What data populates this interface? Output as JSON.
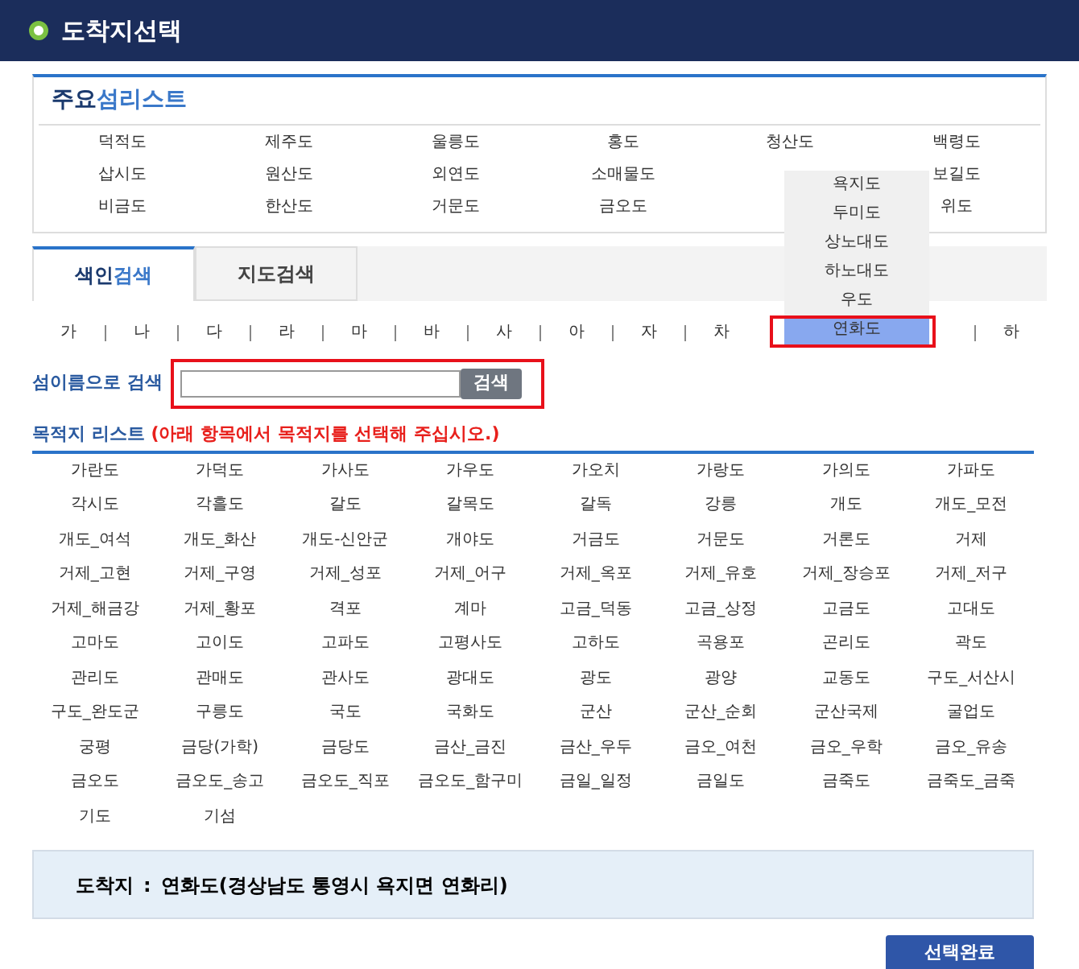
{
  "window": {
    "title": "도착지선택"
  },
  "major_islands": {
    "title": [
      "주요",
      "섬리스트"
    ],
    "rows": [
      [
        "덕적도",
        "제주도",
        "울릉도",
        "홍도",
        "청산도",
        "백령도"
      ],
      [
        "삽시도",
        "원산도",
        "외연도",
        "소매물도",
        "보길도"
      ],
      [
        "비금도",
        "한산도",
        "거문도",
        "금오도",
        "위도"
      ]
    ]
  },
  "tabs": [
    {
      "label": [
        "색인",
        "검색"
      ],
      "selected": true
    },
    {
      "label": [
        "지도검색"
      ],
      "selected": false
    }
  ],
  "index_letters": [
    "가",
    "나",
    "다",
    "라",
    "마",
    "바",
    "사",
    "아",
    "자",
    "차",
    "하"
  ],
  "dropdown": [
    {
      "text": "욕지도",
      "selected": false
    },
    {
      "text": "두미도",
      "selected": false
    },
    {
      "text": "상노대도",
      "selected": false
    },
    {
      "text": "하노대도",
      "selected": false
    },
    {
      "text": "우도",
      "selected": false
    },
    {
      "text": "연화도",
      "selected": true
    }
  ],
  "search": {
    "label": "섬이름으로 검색",
    "button": "검색"
  },
  "destination_list": {
    "title": "목적지 리스트",
    "hint": "(아래 항목에서 목적지를 선택해 주십시오.)",
    "items": [
      "가란도",
      "가덕도",
      "가사도",
      "가우도",
      "가오치",
      "가랑도",
      "가의도",
      "가파도",
      "각시도",
      "각흘도",
      "갈도",
      "갈목도",
      "갈독",
      "강릉",
      "개도",
      "개도_모전",
      "개도_여석",
      "개도_화산",
      "개도-신안군",
      "개야도",
      "거금도",
      "거문도",
      "거론도",
      "거제",
      "거제_고현",
      "거제_구영",
      "거제_성포",
      "거제_어구",
      "거제_옥포",
      "거제_유호",
      "거제_장승포",
      "거제_저구",
      "거제_해금강",
      "거제_황포",
      "격포",
      "계마",
      "고금_덕동",
      "고금_상정",
      "고금도",
      "고대도",
      "고마도",
      "고이도",
      "고파도",
      "고평사도",
      "고하도",
      "곡용포",
      "곤리도",
      "곽도",
      "관리도",
      "관매도",
      "관사도",
      "광대도",
      "광도",
      "광양",
      "교동도",
      "구도_서산시",
      "구도_완도군",
      "구릉도",
      "국도",
      "국화도",
      "군산",
      "군산_순회",
      "군산국제",
      "굴업도",
      "궁평",
      "금당(가학)",
      "금당도",
      "금산_금진",
      "금산_우두",
      "금오_여천",
      "금오_우학",
      "금오_유송",
      "금오도",
      "금오도_송고",
      "금오도_직포",
      "금오도_함구미",
      "금일_일정",
      "금일도",
      "금죽도",
      "금죽도_금죽",
      "기도",
      "기섬"
    ]
  },
  "destination": {
    "label": "도착지",
    "separator": ":",
    "value": "연화도(경상남도 통영시 욕지면 연화리)"
  },
  "confirm_button": "선택완료"
}
